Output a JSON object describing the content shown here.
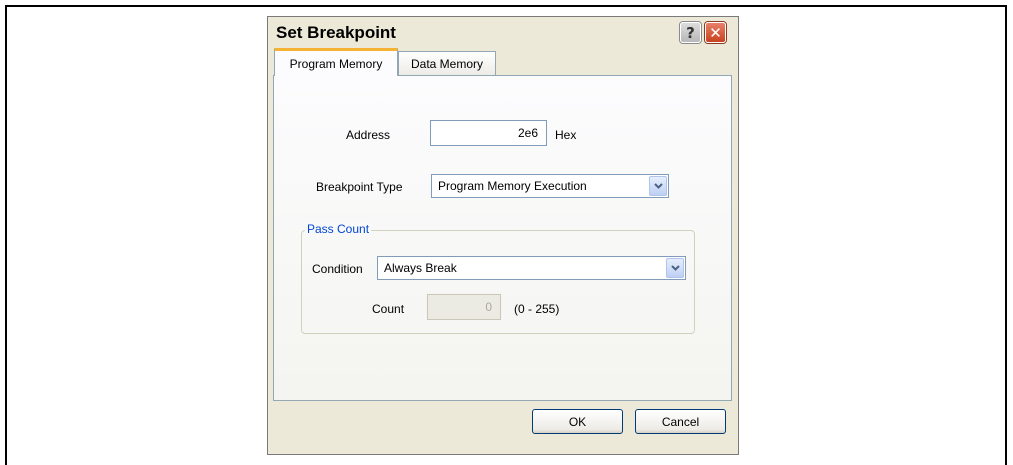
{
  "dialog": {
    "title": "Set Breakpoint",
    "help_glyph": "?",
    "close_glyph": "✕"
  },
  "tabs": [
    {
      "label": "Program Memory",
      "active": true
    },
    {
      "label": "Data Memory",
      "active": false
    }
  ],
  "form": {
    "address_label": "Address",
    "address_value": "2e6",
    "address_suffix": "Hex",
    "breakpoint_type_label": "Breakpoint Type",
    "breakpoint_type_value": "Program Memory Execution"
  },
  "pass_count": {
    "legend": "Pass Count",
    "condition_label": "Condition",
    "condition_value": "Always Break",
    "count_label": "Count",
    "count_value": "0",
    "count_range": "(0 - 255)"
  },
  "buttons": {
    "ok": "OK",
    "cancel": "Cancel"
  },
  "colors": {
    "accent_tab": "#f5b233",
    "group_legend": "#0046d5",
    "close_button": "#c8421e"
  },
  "icons": {
    "help": "help-icon",
    "close": "close-icon",
    "dropdown": "chevron-down-icon"
  }
}
